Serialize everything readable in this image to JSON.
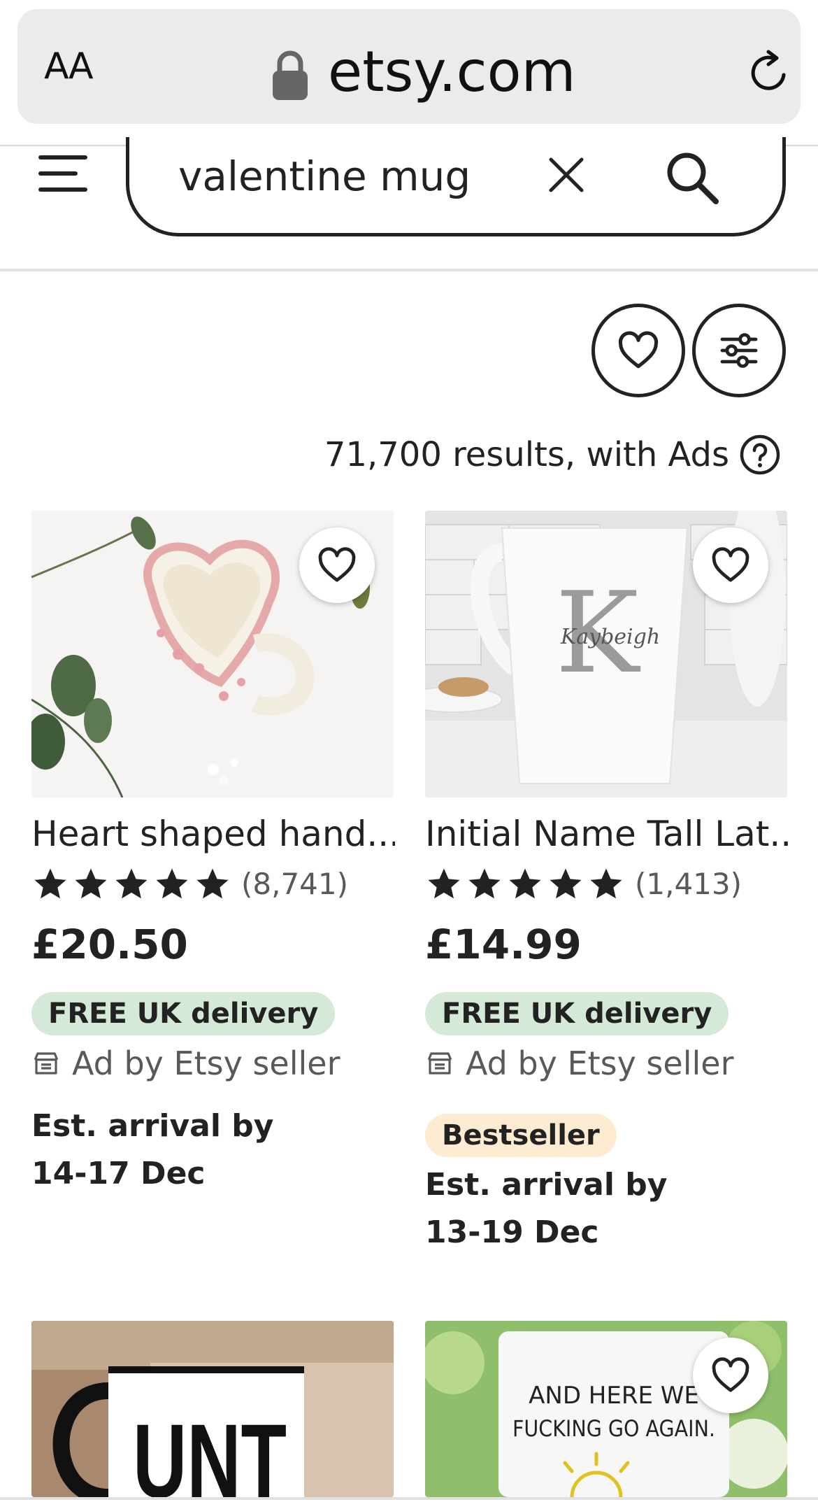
{
  "browser": {
    "text_size_label": "AA",
    "domain": "etsy.com"
  },
  "header": {
    "search_value": "valentine mug"
  },
  "results": {
    "count_text": "71,700 results, with Ads"
  },
  "listings": [
    {
      "title": "Heart shaped hand...",
      "rating_count": "(8,741)",
      "stars": 5,
      "price": "£20.50",
      "delivery_badge": "FREE UK delivery",
      "seller_label": "Ad by Etsy seller",
      "arrival_line1": "Est. arrival by",
      "arrival_line2": "14-17 Dec"
    },
    {
      "title": "Initial Name Tall Lat...",
      "rating_count": "(1,413)",
      "stars": 5,
      "price": "£14.99",
      "delivery_badge": "FREE UK delivery",
      "seller_label": "Ad by Etsy seller",
      "bestseller_badge": "Bestseller",
      "arrival_line1": "Est. arrival by",
      "arrival_line2": "13-19 Dec",
      "image_text_initial": "K",
      "image_text_name": "Kaybeigh"
    },
    {
      "image_text": "UNT"
    },
    {
      "image_text_line1": "AND HERE WE",
      "image_text_line2": "FUCKING GO AGAIN."
    }
  ],
  "colors": {
    "text": "#222222",
    "muted": "#595959",
    "delivery_badge_bg": "#d4e9d7",
    "bestseller_badge_bg": "#fdebd2",
    "url_bar_bg": "#ebebeb"
  }
}
